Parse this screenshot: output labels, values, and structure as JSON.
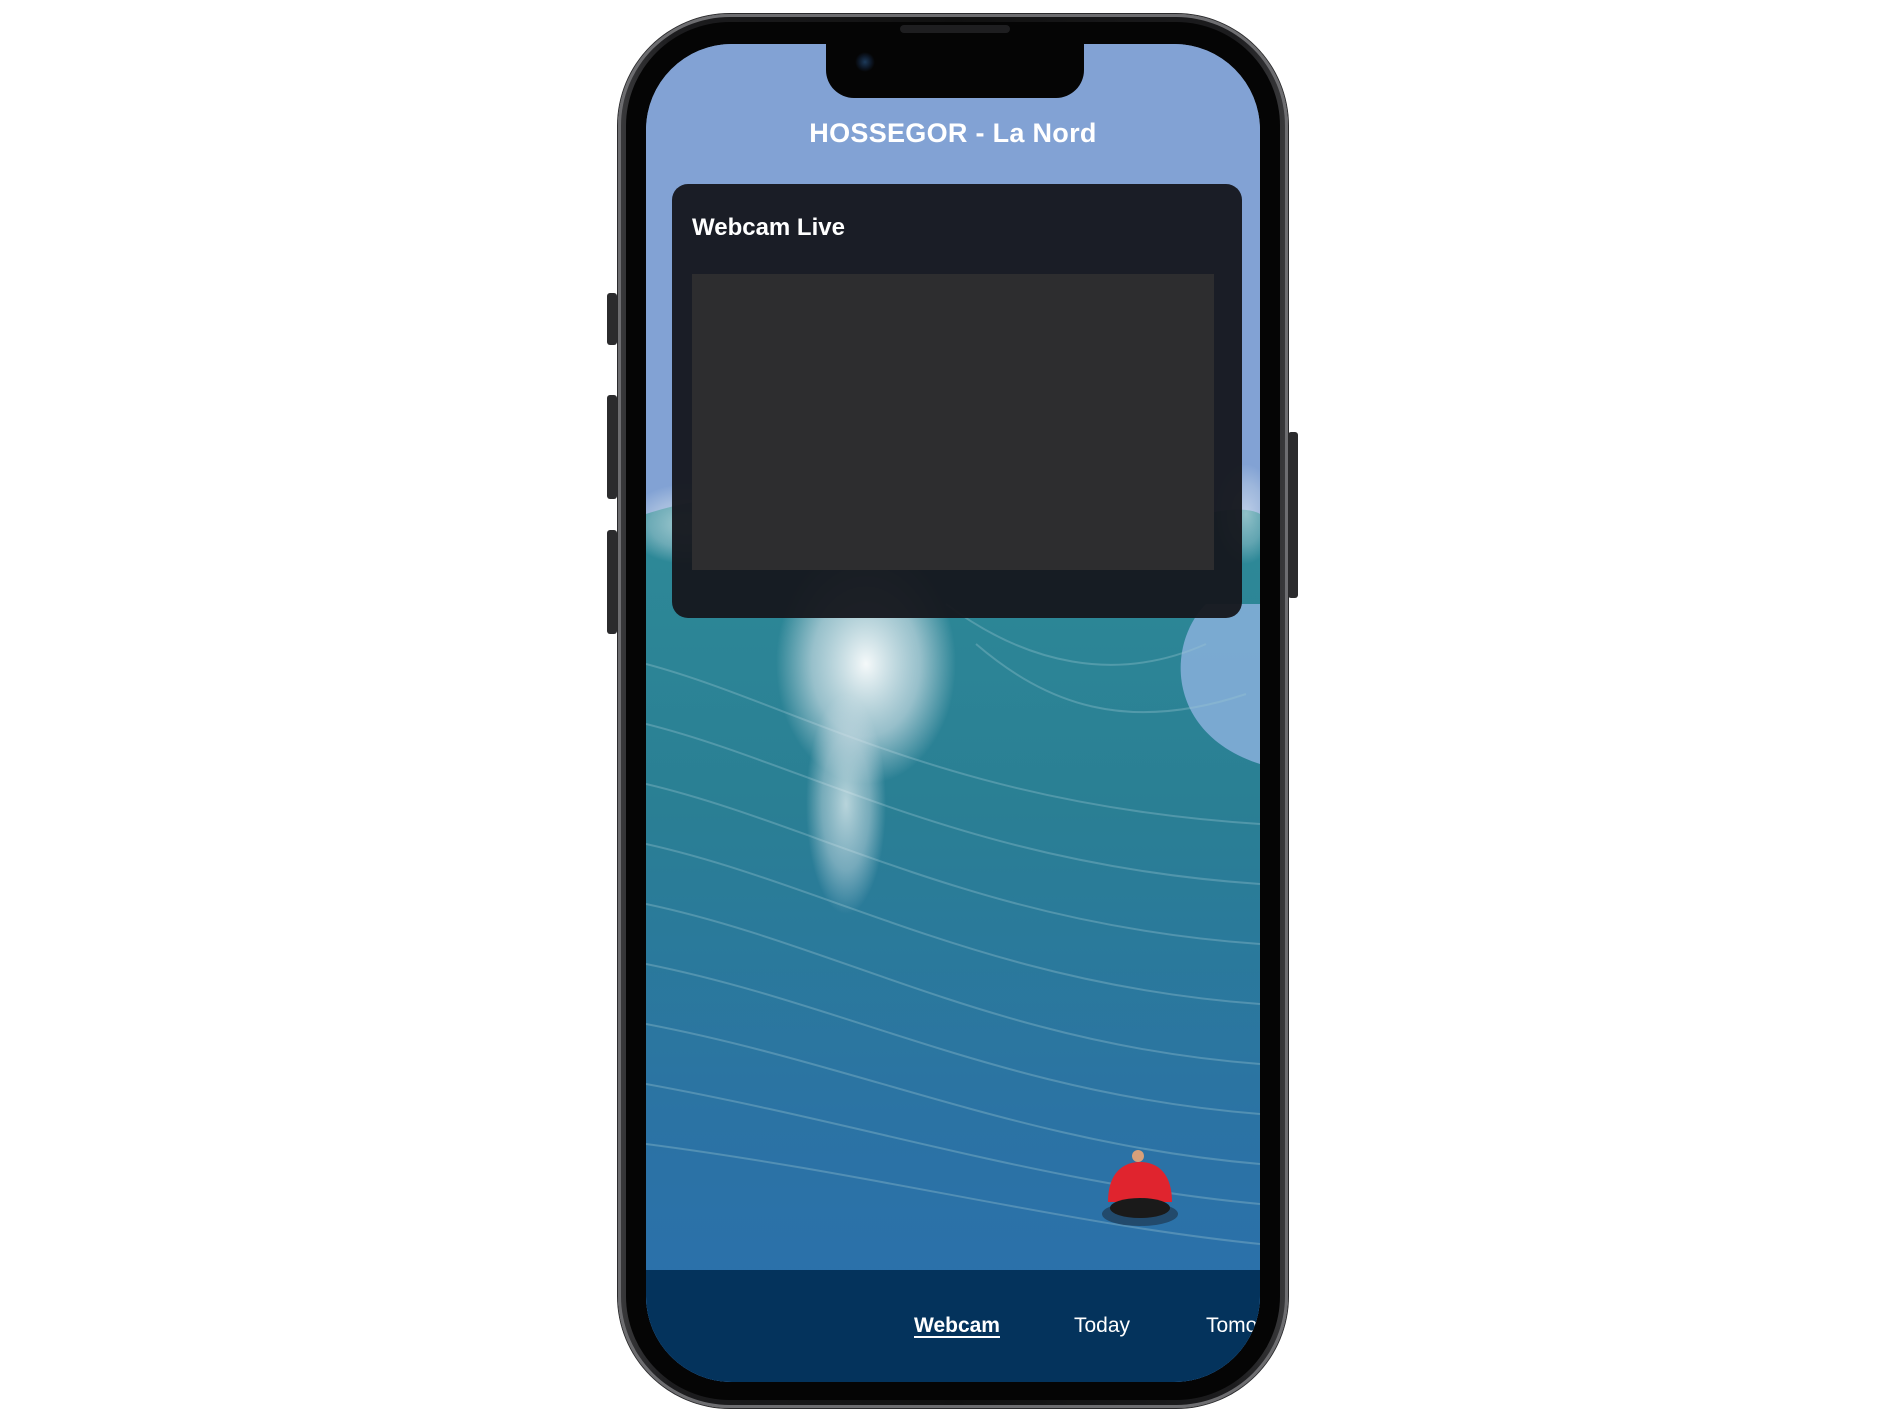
{
  "app": {
    "title": "HOSSEGOR - La Nord"
  },
  "webcam": {
    "heading": "Webcam Live"
  },
  "tabs": [
    {
      "label": "Webcam",
      "active": true
    },
    {
      "label": "Today",
      "active": false
    },
    {
      "label": "Tomor",
      "active": false
    }
  ],
  "colors": {
    "tabbar_background": "#04335c",
    "card_background": "#16181e",
    "video_placeholder": "#2d2d2f",
    "sky": "#86a5d6",
    "wave": "#2a7f94",
    "surfer_jersey": "#e0242e"
  },
  "background_image": "big-wave-surfer"
}
